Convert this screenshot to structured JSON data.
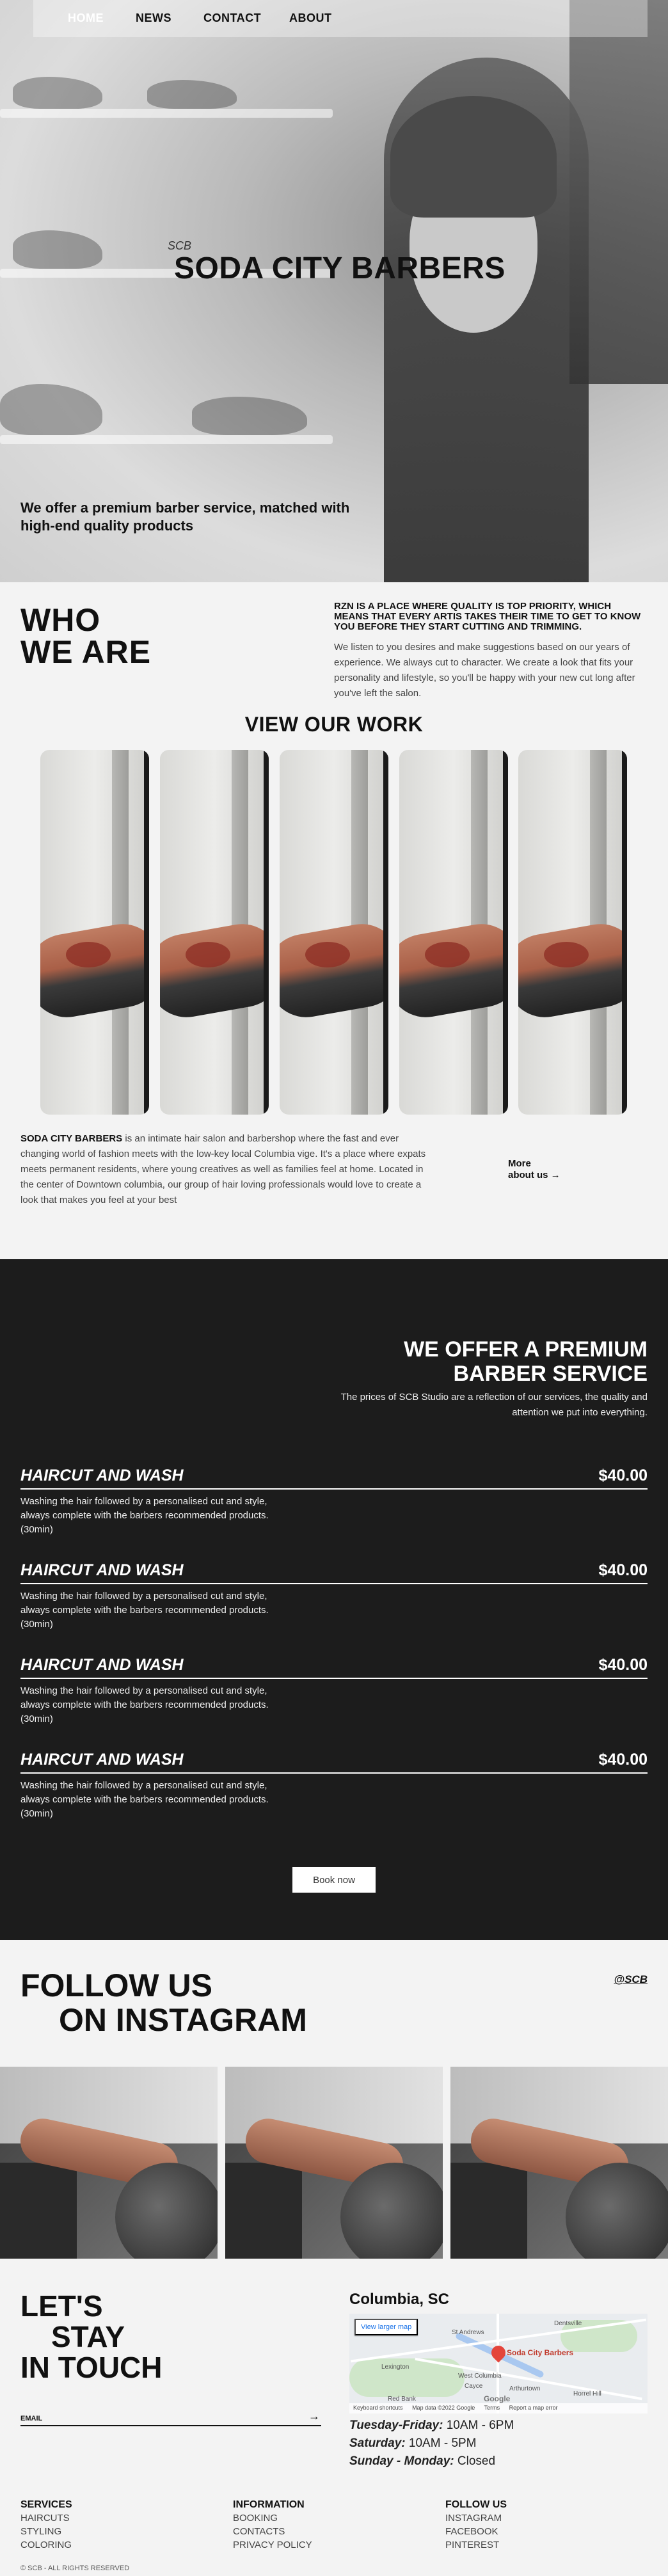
{
  "nav": {
    "home": "HOME",
    "news": "NEWS",
    "contact": "CONTACT",
    "about": "ABOUT"
  },
  "hero": {
    "small_logo": "SCB",
    "title": "SODA CITY BARBERS",
    "subtitle": "We offer a premium barber service, matched with high-end quality products"
  },
  "who": {
    "title_line1": "WHO",
    "title_line2": "WE ARE",
    "headline": "RZN IS A PLACE WHERE QUALITY IS TOP PRIORITY, WHICH MEANS THAT EVERY ARTIS TAKES THEIR TIME TO GET TO KNOW YOU BEFORE THEY START CUTTING AND TRIMMING.",
    "text": "We listen to you desires and make suggestions based on our years of experience. We always cut to character. We create a look that fits your personality and lifestyle, so you'll be happy with your new cut long after you've left the salon."
  },
  "work": {
    "title": "VIEW OUR WORK"
  },
  "about": {
    "brand": "SODA CITY BARBERS",
    "text": " is an intimate hair salon and barbershop where the fast and ever changing world of fashion meets with the low-key local Columbia vige. It's a place where expats meets permanent residents, where young creatives as well as families feel at home. Located in the center of Downtown columbia, our group of hair loving professionals would love to create a look that makes you feel at your best",
    "more_line1": "More",
    "more_line2": "about us →"
  },
  "offer": {
    "title_line1": "WE OFFER A PREMIUM",
    "title_line2": "BARBER SERVICE",
    "text": "The prices of SCB Studio are a reflection of our services, the quality and attention we put into everything."
  },
  "services": [
    {
      "name": "HAIRCUT AND WASH",
      "price": "$40.00",
      "desc": "Washing the hair followed by a personalised cut and style, always complete with the barbers recommended products. (30min)"
    },
    {
      "name": "HAIRCUT AND WASH",
      "price": "$40.00",
      "desc": "Washing the hair followed by a personalised cut and style, always complete with the barbers recommended products. (30min)"
    },
    {
      "name": "HAIRCUT AND WASH",
      "price": "$40.00",
      "desc": "Washing the hair followed by a personalised cut and style, always complete with the barbers recommended products. (30min)"
    },
    {
      "name": "HAIRCUT AND WASH",
      "price": "$40.00",
      "desc": "Washing the hair followed by a personalised cut and style, always complete with the barbers recommended products. (30min)"
    }
  ],
  "book_label": "Book now",
  "instagram": {
    "title_line1": "FOLLOW US",
    "title_line2": "ON INSTAGRAM",
    "handle": "@SCB"
  },
  "contact": {
    "title_line1": "LET'S",
    "title_line2": "STAY",
    "title_line3": "IN TOUCH",
    "email_label": "EMAIL",
    "city": "Columbia, SC"
  },
  "map": {
    "larger_label": "View larger map",
    "pin_label": "Soda City Barbers",
    "places": [
      "St Andrews",
      "Dentsville",
      "Lexington",
      "West Columbia",
      "Cayce",
      "Arthurtown",
      "Red Bank",
      "Horrel Hill"
    ],
    "google": "Google",
    "footer": [
      "Keyboard shortcuts",
      "Map data ©2022 Google",
      "Terms",
      "Report a map error"
    ]
  },
  "hours": [
    {
      "day": "Tuesday-Friday:",
      "time": " 10AM - 6PM"
    },
    {
      "day": "Saturday:",
      "time": " 10AM - 5PM"
    },
    {
      "day": "Sunday - Monday:",
      "time": " Closed"
    }
  ],
  "footer": {
    "services": {
      "title": "SERVICES",
      "items": [
        "HAIRCUTS",
        "STYLING",
        "COLORING"
      ]
    },
    "information": {
      "title": "INFORMATION",
      "items": [
        "BOOKING",
        "CONTACTS",
        "PRIVACY POLICY"
      ]
    },
    "follow": {
      "title": "FOLLOW US",
      "items": [
        "INSTAGRAM",
        "FACEBOOK",
        "PINTEREST"
      ]
    },
    "copyright": "© SCB - ALL RIGHTS RESERVED"
  }
}
